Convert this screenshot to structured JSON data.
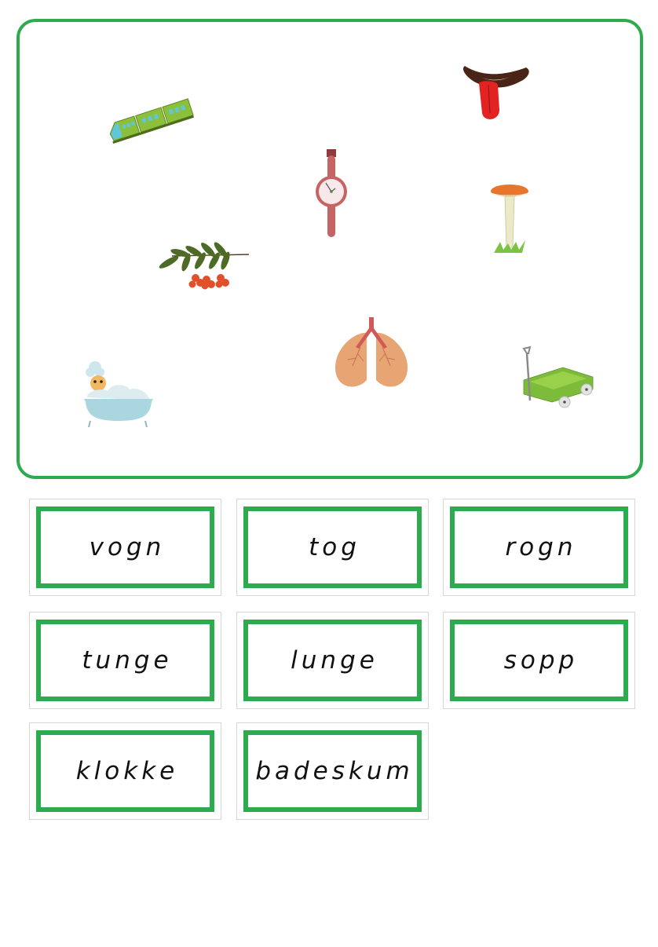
{
  "activity": {
    "border_color": "#2fab4f",
    "images": [
      {
        "id": "train",
        "icon": "train-icon",
        "alt": "tog"
      },
      {
        "id": "tongue",
        "icon": "tongue-icon",
        "alt": "tunge"
      },
      {
        "id": "watch",
        "icon": "watch-icon",
        "alt": "klokke"
      },
      {
        "id": "mushroom",
        "icon": "mushroom-icon",
        "alt": "sopp"
      },
      {
        "id": "rowan",
        "icon": "rowan-berries-icon",
        "alt": "rogn"
      },
      {
        "id": "bubble-bath",
        "icon": "bubble-bath-icon",
        "alt": "badeskum"
      },
      {
        "id": "lungs",
        "icon": "lungs-icon",
        "alt": "lunge"
      },
      {
        "id": "wagon",
        "icon": "wagon-icon",
        "alt": "vogn"
      }
    ]
  },
  "word_cards": [
    {
      "word": "vogn"
    },
    {
      "word": "tog"
    },
    {
      "word": "rogn"
    },
    {
      "word": "tunge"
    },
    {
      "word": "lunge"
    },
    {
      "word": "sopp"
    },
    {
      "word": "klokke"
    },
    {
      "word": "badeskum"
    }
  ]
}
